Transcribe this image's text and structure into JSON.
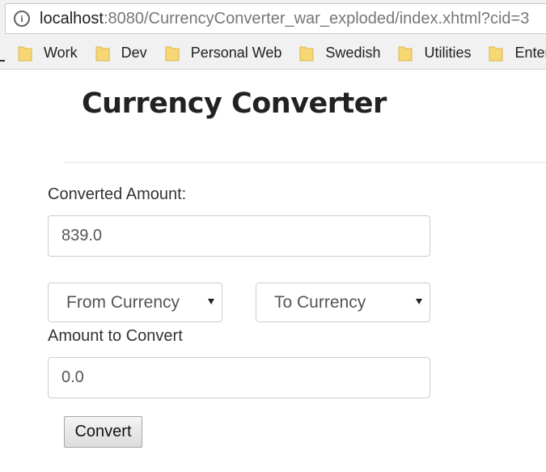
{
  "browser": {
    "url_host": "localhost",
    "url_rest": ":8080/CurrencyConverter_war_exploded/index.xhtml?cid=3",
    "bookmarks": [
      "Work",
      "Dev",
      "Personal Web",
      "Swedish",
      "Utilities",
      "Enter"
    ]
  },
  "page": {
    "title": "Currency Converter",
    "converted_label": "Converted Amount:",
    "converted_value": "839.0",
    "from_select": "From Currency",
    "to_select": "To Currency",
    "amount_label": "Amount to Convert",
    "amount_value": "0.0",
    "convert_button": "Convert"
  },
  "colors": {
    "folder": "#f7d774",
    "chrome_bg": "#f1f1f1"
  }
}
